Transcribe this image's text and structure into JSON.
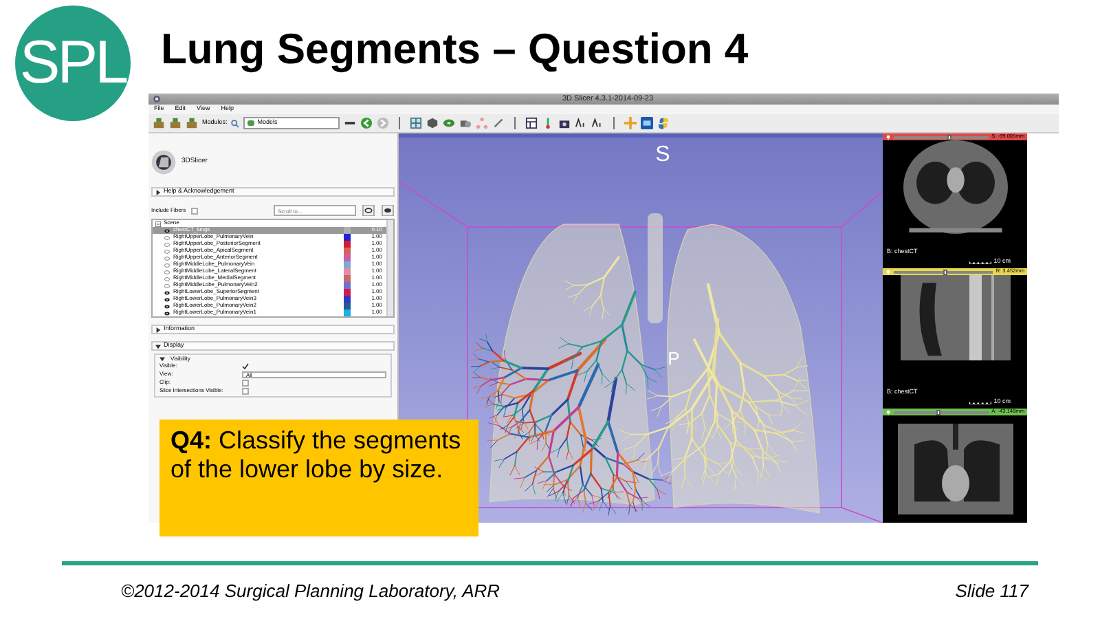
{
  "logo": {
    "text": "SPL"
  },
  "title": "Lung Segments – Question 4",
  "app": {
    "window_title": "3D Slicer 4.3.1-2014-09-23",
    "menu": [
      "File",
      "Edit",
      "View",
      "Help"
    ],
    "modules_label": "Modules:",
    "module": "Models",
    "module_panel": {
      "brand": "3DSlicer",
      "help_section": {
        "label": "Help & Acknowledgement",
        "expanded": false
      },
      "include_fibers": {
        "label": "Include Fibers",
        "checked": false
      },
      "scroll_field": {
        "placeholder": "Scroll to..."
      },
      "scene": {
        "label": "Scene",
        "expanded": true,
        "models": [
          {
            "name": "chestCT_lungs",
            "visible": true,
            "selected": true,
            "color": "#b0b0b0",
            "opacity": "0.10"
          },
          {
            "name": "RightUpperLobe_PulmonaryVein",
            "visible": false,
            "selected": false,
            "color": "#2222d8",
            "opacity": "1.00"
          },
          {
            "name": "RightUpperLobe_PosteriorSegment",
            "visible": false,
            "selected": false,
            "color": "#d01c34",
            "opacity": "1.00"
          },
          {
            "name": "RightUpperLobe_ApicalSegment",
            "visible": false,
            "selected": false,
            "color": "#d86060",
            "opacity": "1.00"
          },
          {
            "name": "RightUpperLobe_AnteriorSegment",
            "visible": false,
            "selected": false,
            "color": "#c860a8",
            "opacity": "1.00"
          },
          {
            "name": "RightMiddleLobe_PulmonaryVein",
            "visible": false,
            "selected": false,
            "color": "#80a8d8",
            "opacity": "1.00"
          },
          {
            "name": "RightMiddleLobe_LateralSegment",
            "visible": false,
            "selected": false,
            "color": "#e090a0",
            "opacity": "1.00"
          },
          {
            "name": "RightMiddleLobe_MedialSegment",
            "visible": false,
            "selected": false,
            "color": "#c86868",
            "opacity": "1.00"
          },
          {
            "name": "RightMiddleLobe_PulmonaryVein2",
            "visible": false,
            "selected": false,
            "color": "#7070d0",
            "opacity": "1.00"
          },
          {
            "name": "RightLowerLobe_SuperiorSegment",
            "visible": true,
            "selected": false,
            "color": "#d01c50",
            "opacity": "1.00"
          },
          {
            "name": "RightLowerLobe_PulmonaryVein3",
            "visible": true,
            "selected": false,
            "color": "#3038c0",
            "opacity": "1.00"
          },
          {
            "name": "RightLowerLobe_PulmonaryVein2",
            "visible": true,
            "selected": false,
            "color": "#205c98",
            "opacity": "1.00"
          },
          {
            "name": "RightLowerLobe_PulmonaryVein1",
            "visible": true,
            "selected": false,
            "color": "#20b0e8",
            "opacity": "1.00"
          }
        ]
      },
      "information_section": {
        "label": "Information",
        "expanded": false
      },
      "display_section": {
        "label": "Display",
        "expanded": true
      },
      "visibility_group": {
        "label": "Visibility",
        "expanded": true
      },
      "display_fields": [
        {
          "kind": "checkbox",
          "label": "Visible:",
          "checked": true
        },
        {
          "kind": "select",
          "label": "View:",
          "value": "All"
        },
        {
          "kind": "checkbox",
          "label": "Clip:",
          "checked": false
        },
        {
          "kind": "checkbox",
          "label": "Slice Intersections Visible:",
          "checked": false
        }
      ]
    },
    "view_3d": {
      "orientation_labels": [
        "S",
        "P"
      ]
    },
    "slice_views": [
      {
        "kind": "axial",
        "color": "#e04848",
        "reading": "S: -99.005mm",
        "level": 0.6,
        "volume": "B: chestCT",
        "scale": "10 cm"
      },
      {
        "kind": "sagittal",
        "color": "#e8d850",
        "reading": "R: 3.452mm",
        "level": 0.52,
        "volume": "B: chestCT",
        "scale": "10 cm"
      },
      {
        "kind": "coronal",
        "color": "#70c050",
        "reading": "A: -43.148mm",
        "level": 0.48
      }
    ]
  },
  "question": {
    "text": "**Q4:** Classify the segments of the lower lobe by size."
  },
  "footer": {
    "copyright": "©2012-2014 Surgical Planning Laboratory, ARR",
    "slide": "Slide 117"
  }
}
